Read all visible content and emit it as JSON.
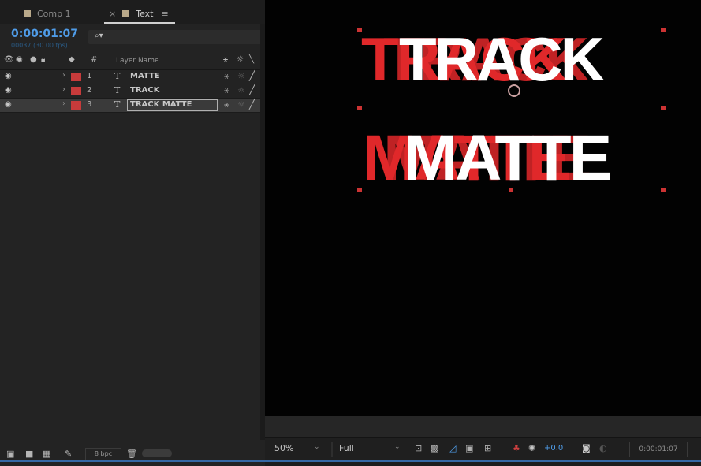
{
  "timeline": {
    "tabs": [
      {
        "label": "Comp 1",
        "close": ""
      },
      {
        "label": "Text",
        "close": "×",
        "menu": "≡"
      }
    ],
    "current_time": "0:00:01:07",
    "frame_info": "00037 (30.00 fps)",
    "search_placeholder": "",
    "column_header": {
      "layer_name": "Layer Name",
      "number_symbol": "#"
    },
    "layers": [
      {
        "number": "1",
        "type_icon": "T",
        "name": "MATTE",
        "color": "#c73b3b",
        "selected": false
      },
      {
        "number": "2",
        "type_icon": "T",
        "name": "TRACK",
        "color": "#c73b3b",
        "selected": false
      },
      {
        "number": "3",
        "type_icon": "T",
        "name": "TRACK MATTE",
        "color": "#c73b3b",
        "selected": true
      }
    ],
    "bottom": {
      "bit_depth": "8 bpc"
    }
  },
  "viewer": {
    "text_line1": "TRACK",
    "text_line2": "MATTE",
    "text_color": "#ffffff",
    "echo_color": "#e0282a",
    "zoom": "50%",
    "resolution": "Full",
    "exposure": "+0.0",
    "timecode": "0:00:01:07"
  },
  "colors": {
    "accent_blue": "#4f9ce8",
    "layer_red": "#c73b3b"
  }
}
